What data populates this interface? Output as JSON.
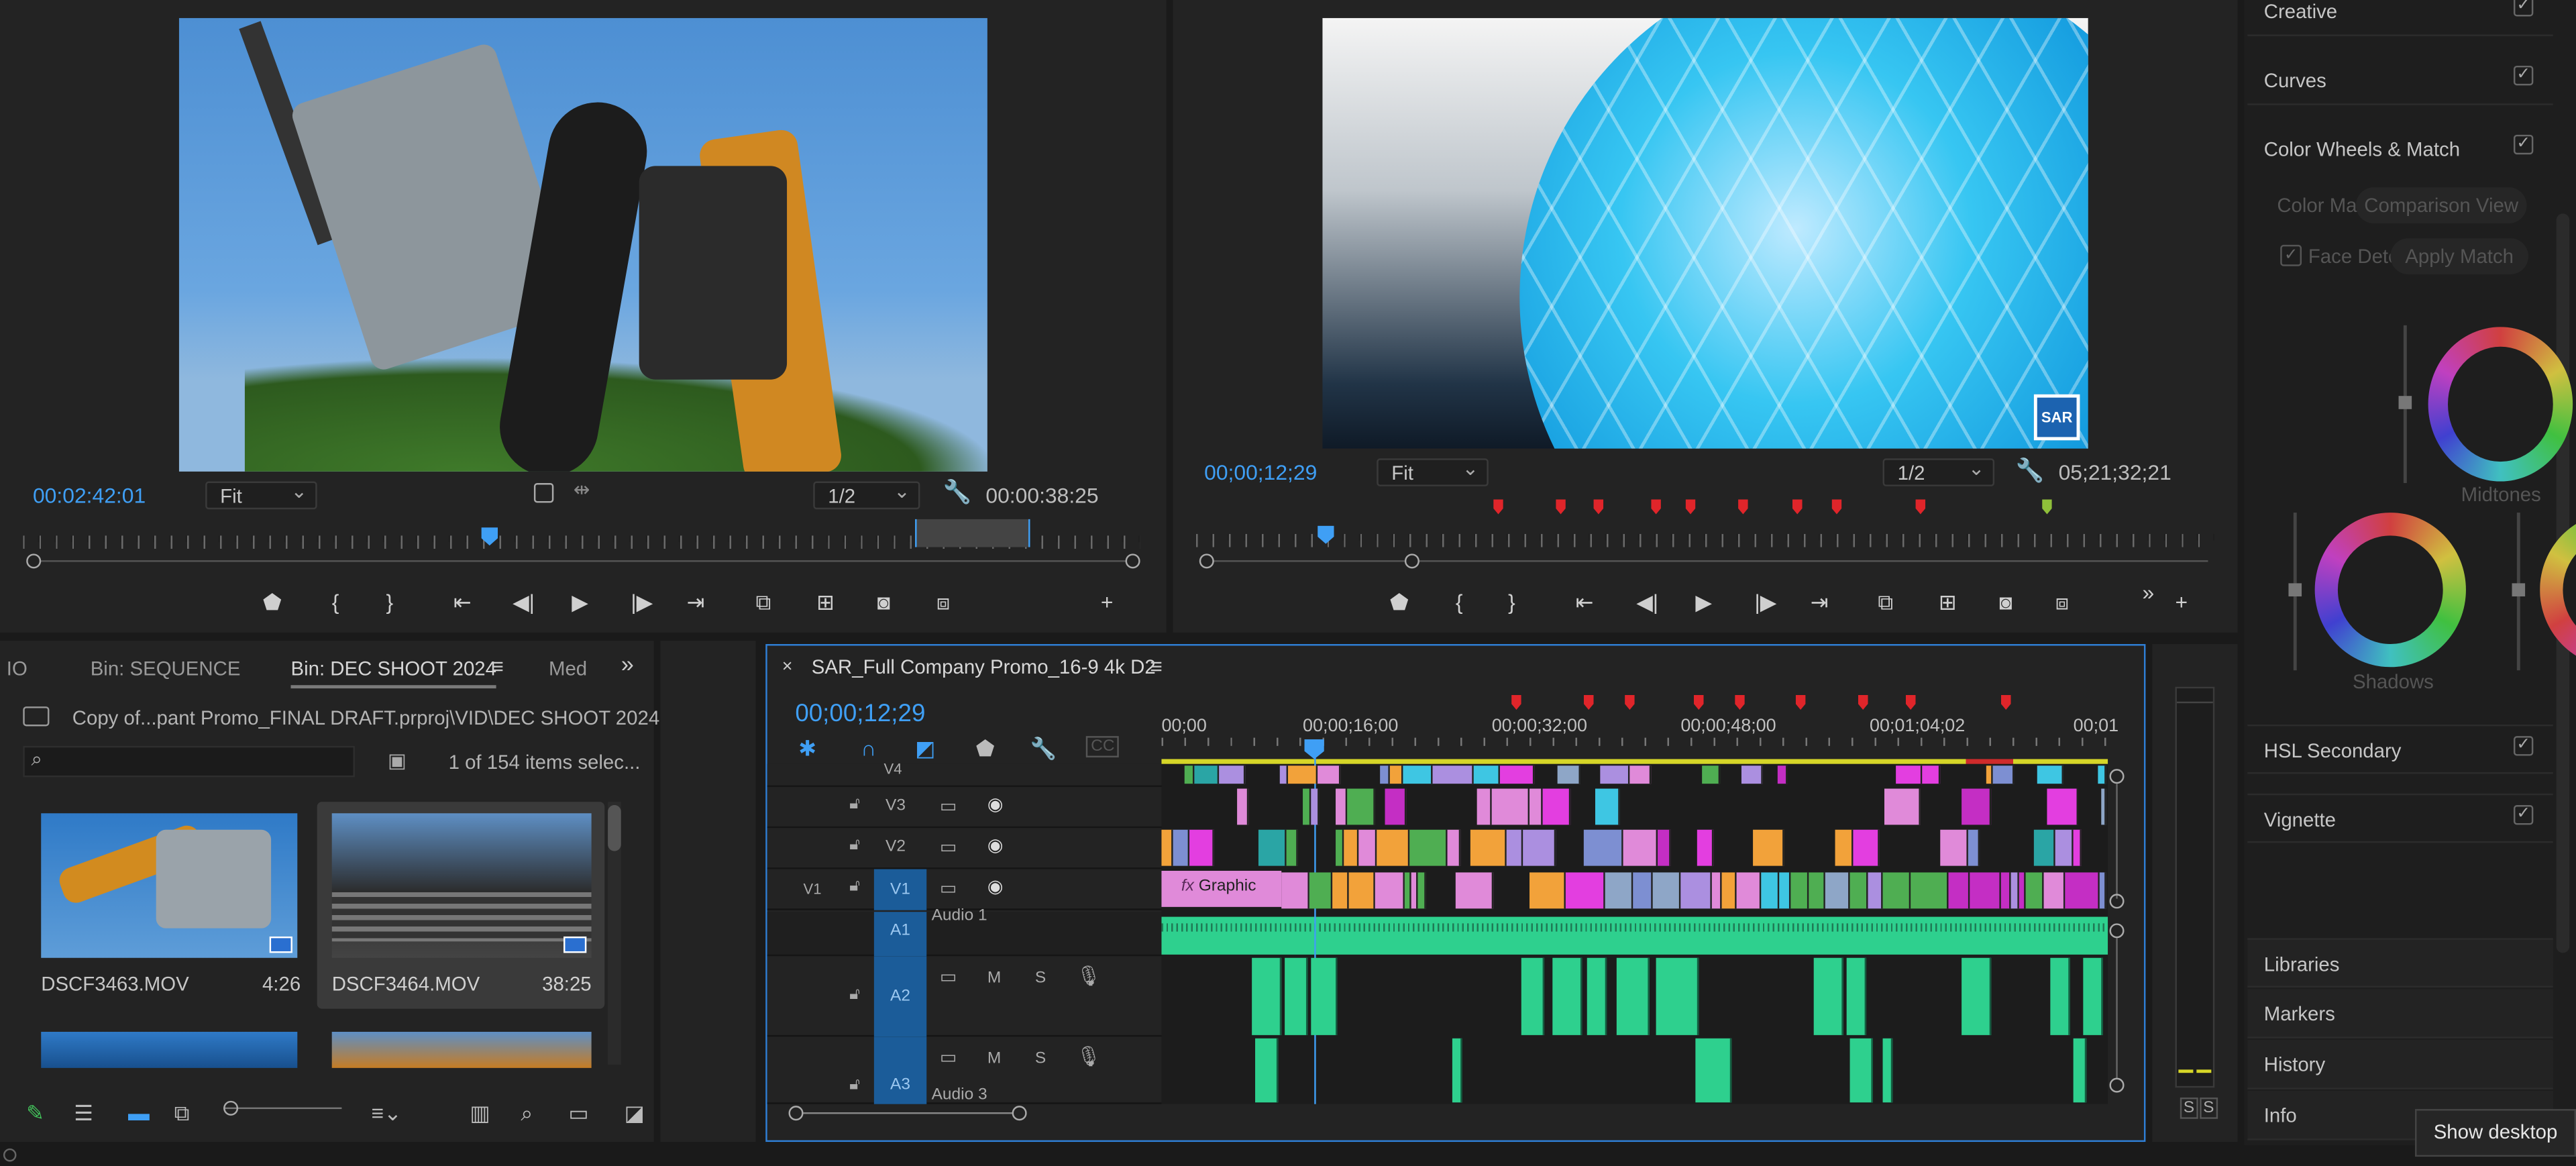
{
  "source_monitor": {
    "timecode": "00:02:42:01",
    "fit": "Fit",
    "resolution": "1/2",
    "duration": "00:00:38:25"
  },
  "program_monitor": {
    "timecode": "00;00;12;29",
    "fit": "Fit",
    "resolution": "1/2",
    "duration": "05;21;32;21",
    "logo_text": "SAR"
  },
  "project": {
    "tabs": [
      "IO",
      "Bin: SEQUENCE",
      "Bin: DEC SHOOT 2024",
      "Med"
    ],
    "path": "Copy of...pant Promo_FINAL DRAFT.prproj\\VID\\DEC SHOOT 2024",
    "search_placeholder": "",
    "count": "1 of 154 items selec...",
    "items": [
      {
        "name": "DSCF3463.MOV",
        "duration": "4:26"
      },
      {
        "name": "DSCF3464.MOV",
        "duration": "38:25"
      }
    ]
  },
  "timeline": {
    "title": "SAR_Full Company Promo_16-9 4k D2",
    "timecode": "00;00;12;29",
    "ruler": [
      "00;00",
      "00;00;16;00",
      "00;00;32;00",
      "00;00;48;00",
      "00;01;04;02",
      "00;01"
    ],
    "video_tracks": [
      {
        "src": "",
        "name": "V4"
      },
      {
        "src": "",
        "name": "V3"
      },
      {
        "src": "",
        "name": "V2"
      },
      {
        "src": "V1",
        "name": "V1"
      }
    ],
    "audio_tracks": [
      {
        "name": "A1",
        "label": "Audio 1"
      },
      {
        "name": "A2",
        "label": ""
      },
      {
        "name": "A3",
        "label": "Audio 3"
      }
    ],
    "graphic_clip": "Graphic",
    "track_buttons": {
      "m": "M",
      "s": "S"
    }
  },
  "lumetri": {
    "sections": [
      "Creative",
      "Curves",
      "Color Wheels & Match"
    ],
    "color_match": "Color Ma",
    "comparison_view": "Comparison View",
    "face_detect": "Face Dete",
    "apply_match": "Apply Match",
    "wheels": [
      "Midtones",
      "Shadows"
    ],
    "sections2": [
      "HSL Secondary",
      "Vignette"
    ],
    "panels": [
      "Libraries",
      "Markers",
      "History",
      "Info"
    ]
  },
  "audio_meter": {
    "labels": [
      "S",
      "S"
    ]
  },
  "tooltip": "Show desktop"
}
